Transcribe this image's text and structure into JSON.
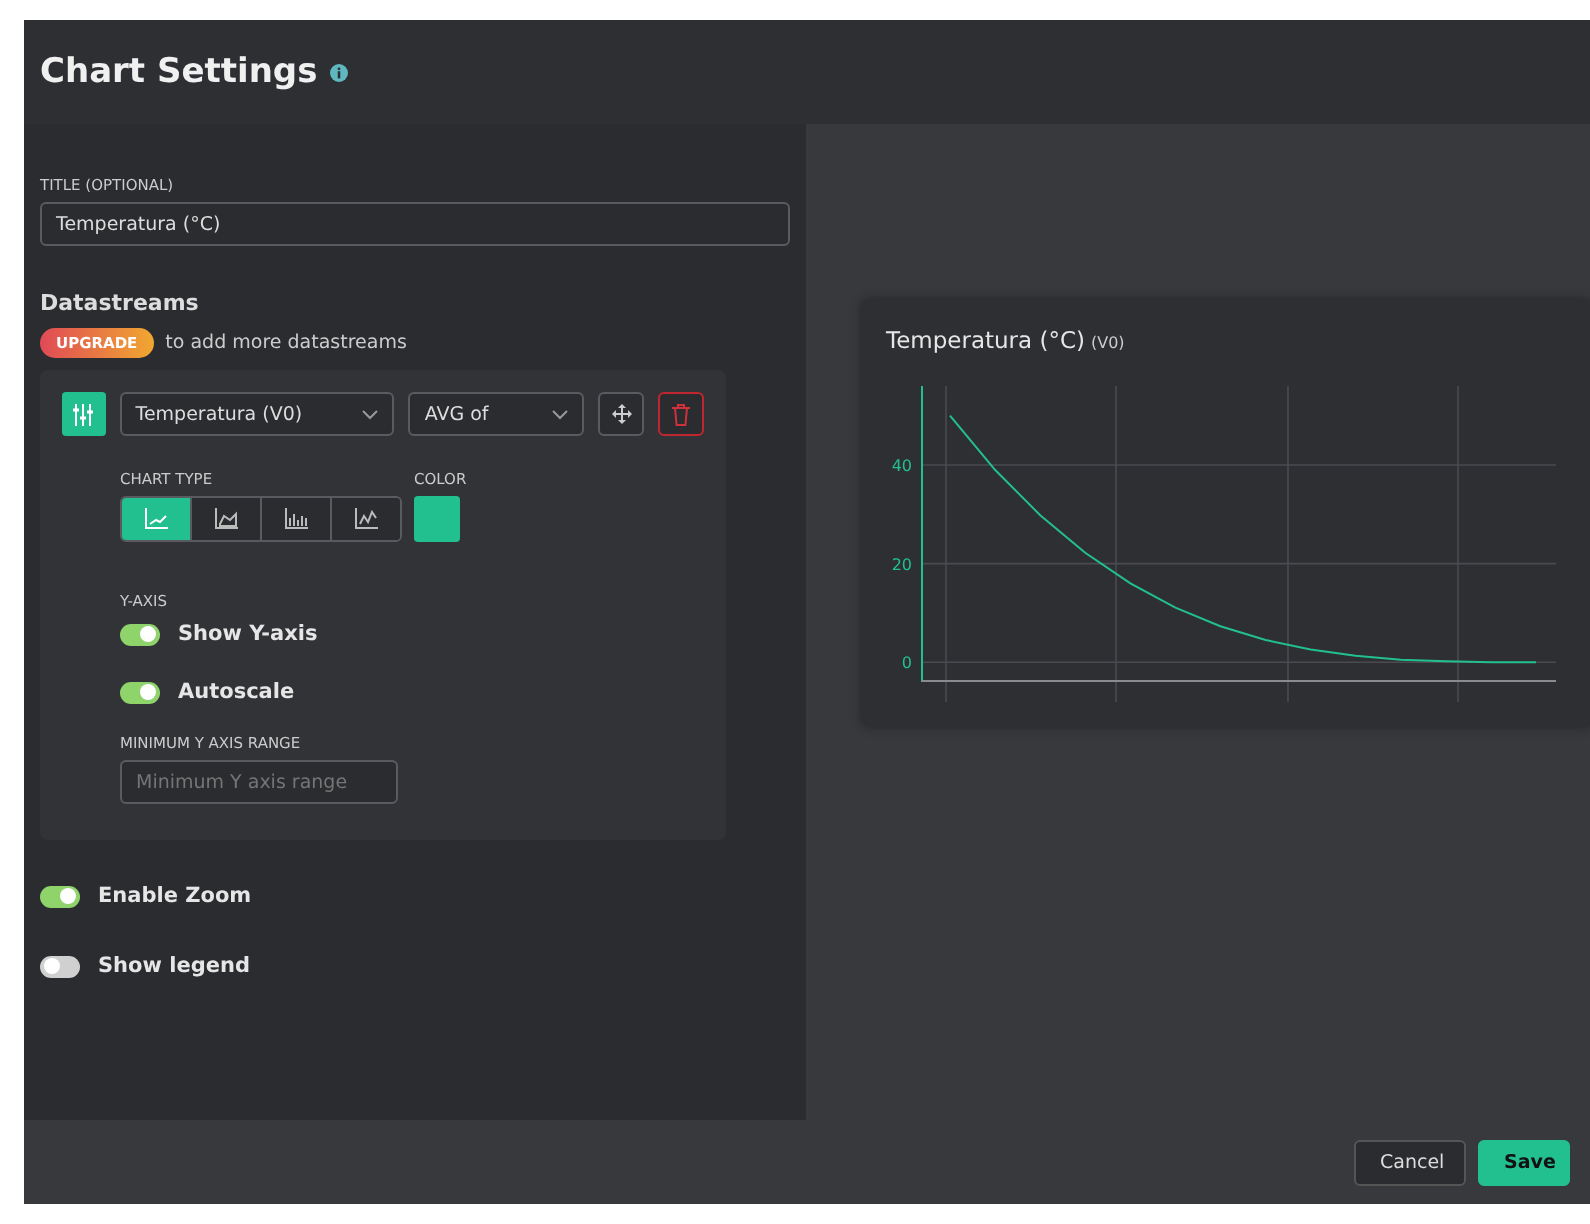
{
  "header": {
    "title": "Chart Settings"
  },
  "title_field": {
    "label": "TITLE (OPTIONAL)",
    "value": "Temperatura (°C)"
  },
  "datastreams": {
    "heading": "Datastreams",
    "upgrade": "UPGRADE",
    "upgrade_note": "to add more datastreams",
    "stream": {
      "source": "Temperatura (V0)",
      "aggregation": "AVG of",
      "chart_type_label": "CHART TYPE",
      "chart_types": [
        {
          "kind": "line",
          "selected": true
        },
        {
          "kind": "area",
          "selected": false
        },
        {
          "kind": "bar",
          "selected": false
        },
        {
          "kind": "step",
          "selected": false
        }
      ],
      "color_label": "COLOR",
      "color": "#22c08f",
      "y_axis_label": "Y-AXIS",
      "toggles": [
        {
          "label": "Show Y-axis",
          "on": true
        },
        {
          "label": "Autoscale",
          "on": true
        }
      ],
      "min_range_label": "MINIMUM Y AXIS RANGE",
      "min_range": {
        "placeholder": "Minimum Y axis range"
      }
    }
  },
  "options": [
    {
      "label": "Enable Zoom",
      "on": true
    },
    {
      "label": "Show legend",
      "on": false
    }
  ],
  "preview": {
    "title": "Temperatura (°C)",
    "subtitle": "(V0)",
    "chart_data": {
      "type": "line",
      "grid": true,
      "yticks": [
        0,
        20,
        40
      ],
      "ylim": [
        -4,
        56
      ],
      "series": [
        {
          "color": "#22c08f",
          "values": [
            50,
            39,
            29.8,
            22.2,
            16,
            11.1,
            7.3,
            4.5,
            2.6,
            1.3,
            0.5,
            0.2,
            0,
            0
          ]
        }
      ]
    }
  },
  "buttons": [
    {
      "label": "Cancel",
      "kind": "secondary"
    },
    {
      "label": "Save",
      "kind": "primary"
    }
  ]
}
